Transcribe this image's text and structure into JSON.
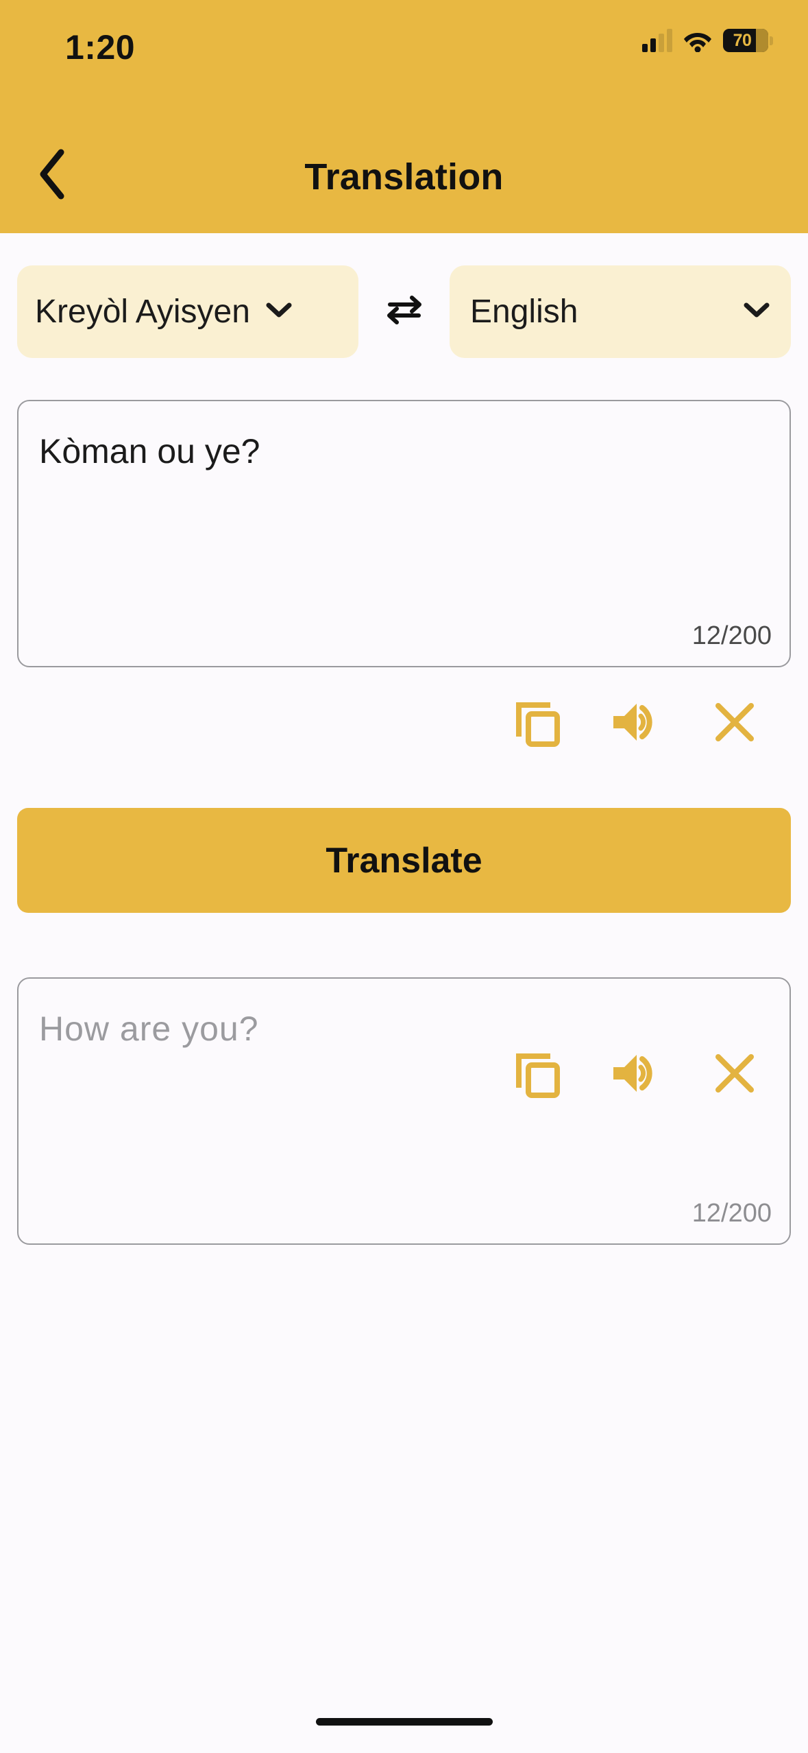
{
  "status_bar": {
    "time": "1:20",
    "battery_level": "70",
    "signal_icon": "cellular-signal-icon",
    "wifi_icon": "wifi-icon",
    "battery_icon": "battery-icon"
  },
  "header": {
    "title": "Translation",
    "back_icon": "chevron-left-icon"
  },
  "language_selector": {
    "source_language": "Kreyòl Ayisyen",
    "target_language": "English",
    "swap_icon": "swap-horizontal-icon",
    "chevron_icon": "chevron-down-icon"
  },
  "source_area": {
    "text": "Kòman ou ye?",
    "char_count": "12/200",
    "actions": [
      {
        "name": "copy-icon",
        "label": "Copy"
      },
      {
        "name": "speaker-icon",
        "label": "Speak"
      },
      {
        "name": "close-icon",
        "label": "Clear"
      }
    ]
  },
  "translate_button": {
    "label": "Translate"
  },
  "target_area": {
    "placeholder": "How are you?",
    "char_count": "12/200",
    "actions": [
      {
        "name": "copy-icon",
        "label": "Copy"
      },
      {
        "name": "speaker-icon",
        "label": "Speak"
      },
      {
        "name": "close-icon",
        "label": "Clear"
      }
    ]
  },
  "colors": {
    "accent": "#E8B842",
    "pill_background": "#FAF0D2",
    "page_background": "#FCFAFD",
    "icon_gold": "#E3B340",
    "border_grey": "#9A9A9E"
  }
}
